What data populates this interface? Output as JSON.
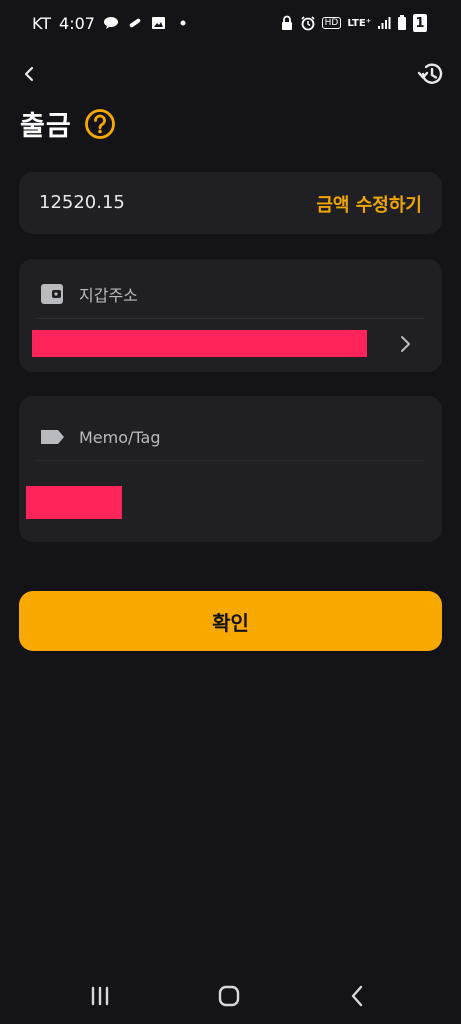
{
  "status_bar": {
    "carrier": "KT",
    "time": "4:07",
    "network": "LTE⁺",
    "hd_label": "HD",
    "battery_label": "1"
  },
  "header": {
    "title": "출금"
  },
  "amount": {
    "value": "12520.15",
    "edit_label": "금액 수정하기"
  },
  "wallet": {
    "label": "지갑주소"
  },
  "memo": {
    "label": "Memo/Tag"
  },
  "confirm": {
    "label": "확인"
  },
  "colors": {
    "accent": "#f8a900",
    "accent_text": "#f0a500",
    "background": "#141418",
    "card": "#1f1f24",
    "redaction": "#ff2459"
  },
  "icons": [
    "back-icon",
    "history-icon",
    "help-icon",
    "wallet-icon",
    "tag-icon",
    "chevron-right-icon",
    "recents-icon",
    "home-icon",
    "system-back-icon"
  ]
}
